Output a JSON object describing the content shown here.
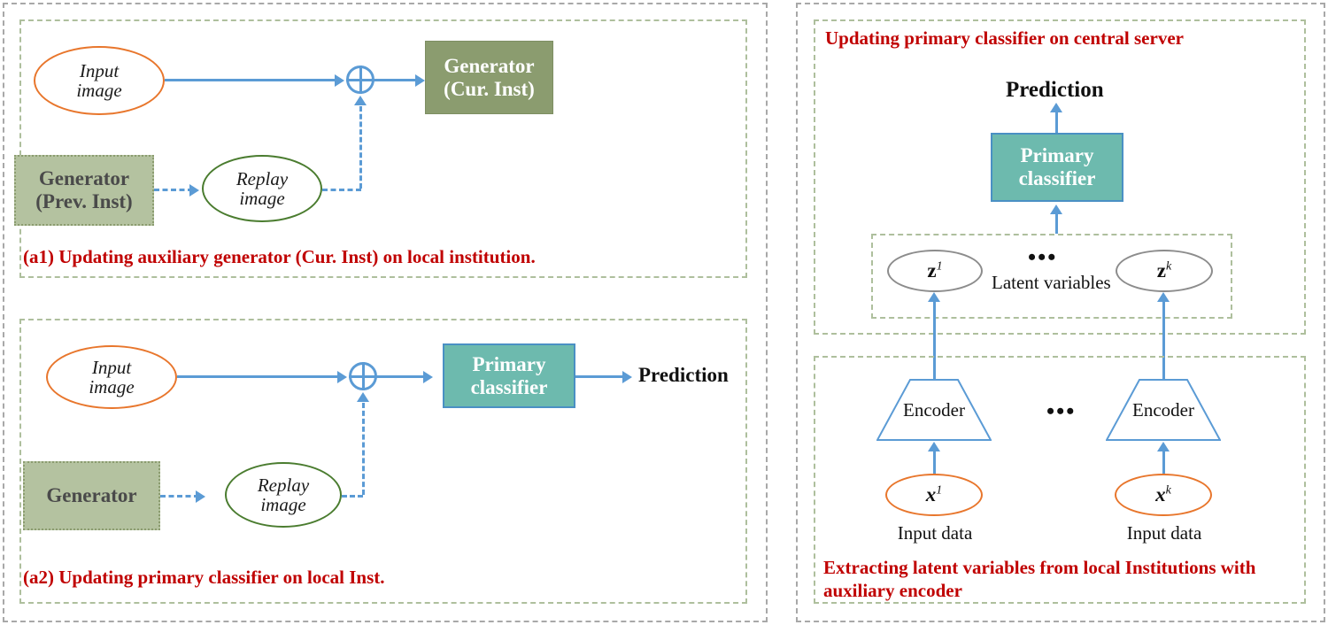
{
  "figure": {
    "title_hidden": "",
    "panels": {
      "left": {
        "a1": {
          "caption": "(a1) Updating auxiliary generator (Cur. Inst) on local institution.",
          "nodes": {
            "input_image": "Input\nimage",
            "input_image_line1": "Input",
            "input_image_line2": "image",
            "generator_cur_line1": "Generator",
            "generator_cur_line2": "(Cur. Inst)",
            "generator_prev_line1": "Generator",
            "generator_prev_line2": "(Prev. Inst)",
            "replay_image_line1": "Replay",
            "replay_image_line2": "image",
            "sum_symbol": "oplus"
          }
        },
        "a2": {
          "caption": "(a2) Updating primary classifier on local Inst.",
          "nodes": {
            "input_image_line1": "Input",
            "input_image_line2": "image",
            "generator": "Generator",
            "replay_image_line1": "Replay",
            "replay_image_line2": "image",
            "primary_classifier_line1": "Primary",
            "primary_classifier_line2": "classifier",
            "prediction": "Prediction",
            "sum_symbol": "oplus"
          }
        }
      },
      "right": {
        "top": {
          "caption": "Updating primary classifier on central server",
          "prediction": "Prediction",
          "primary_classifier_line1": "Primary",
          "primary_classifier_line2": "classifier",
          "latent_box_label": "Latent variables",
          "z_first": "z",
          "z_first_sup": "1",
          "z_last": "z",
          "z_last_sup": "k",
          "ellipsis": "•••"
        },
        "bottom": {
          "caption": "Extracting latent variables from local Institutions with auxiliary encoder",
          "encoder_first": "Encoder",
          "encoder_last": "Encoder",
          "x_first": "x",
          "x_first_sup": "1",
          "x_last": "x",
          "x_last_sup": "k",
          "input_data_first": "Input data",
          "input_data_last": "Input data",
          "ellipsis": "•••"
        }
      }
    },
    "colors": {
      "caption_red": "#C00000",
      "generator_solid_green": "#8b9c6f",
      "generator_light_green": "#b4c2a0",
      "classifier_teal": "#6dbaae",
      "arrow_blue": "#5b9bd5",
      "input_ellipse_orange": "#E8762C",
      "replay_ellipse_green": "#4a7c2f",
      "latent_ellipse_gray": "#8c8c8c",
      "panel_border_gray": "#a8a8a8",
      "panel_border_green": "#aebf9d"
    }
  }
}
